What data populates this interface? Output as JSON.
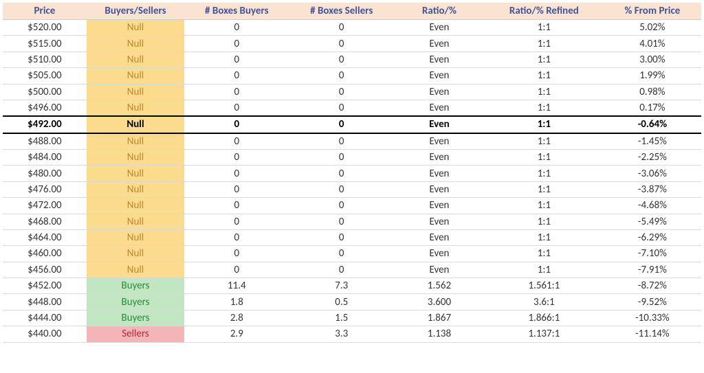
{
  "headers": {
    "price": "Price",
    "bs": "Buyers/Sellers",
    "boxBuyers": "# Boxes Buyers",
    "boxSellers": "# Boxes Sellers",
    "ratio": "Ratio/%",
    "ratioRefined": "Ratio/% Refined",
    "pctFromPrice": "% From Price"
  },
  "rows": [
    {
      "price": "$520.00",
      "bs": "Null",
      "bsClass": "null",
      "boxBuyers": "0",
      "boxSellers": "0",
      "ratio": "Even",
      "ratioRefined": "1:1",
      "pctFromPrice": "5.02%",
      "highlight": false
    },
    {
      "price": "$515.00",
      "bs": "Null",
      "bsClass": "null",
      "boxBuyers": "0",
      "boxSellers": "0",
      "ratio": "Even",
      "ratioRefined": "1:1",
      "pctFromPrice": "4.01%",
      "highlight": false
    },
    {
      "price": "$510.00",
      "bs": "Null",
      "bsClass": "null",
      "boxBuyers": "0",
      "boxSellers": "0",
      "ratio": "Even",
      "ratioRefined": "1:1",
      "pctFromPrice": "3.00%",
      "highlight": false
    },
    {
      "price": "$505.00",
      "bs": "Null",
      "bsClass": "null",
      "boxBuyers": "0",
      "boxSellers": "0",
      "ratio": "Even",
      "ratioRefined": "1:1",
      "pctFromPrice": "1.99%",
      "highlight": false
    },
    {
      "price": "$500.00",
      "bs": "Null",
      "bsClass": "null",
      "boxBuyers": "0",
      "boxSellers": "0",
      "ratio": "Even",
      "ratioRefined": "1:1",
      "pctFromPrice": "0.98%",
      "highlight": false
    },
    {
      "price": "$496.00",
      "bs": "Null",
      "bsClass": "null",
      "boxBuyers": "0",
      "boxSellers": "0",
      "ratio": "Even",
      "ratioRefined": "1:1",
      "pctFromPrice": "0.17%",
      "highlight": false
    },
    {
      "price": "$492.00",
      "bs": "Null",
      "bsClass": "null",
      "boxBuyers": "0",
      "boxSellers": "0",
      "ratio": "Even",
      "ratioRefined": "1:1",
      "pctFromPrice": "-0.64%",
      "highlight": true
    },
    {
      "price": "$488.00",
      "bs": "Null",
      "bsClass": "null",
      "boxBuyers": "0",
      "boxSellers": "0",
      "ratio": "Even",
      "ratioRefined": "1:1",
      "pctFromPrice": "-1.45%",
      "highlight": false
    },
    {
      "price": "$484.00",
      "bs": "Null",
      "bsClass": "null",
      "boxBuyers": "0",
      "boxSellers": "0",
      "ratio": "Even",
      "ratioRefined": "1:1",
      "pctFromPrice": "-2.25%",
      "highlight": false
    },
    {
      "price": "$480.00",
      "bs": "Null",
      "bsClass": "null",
      "boxBuyers": "0",
      "boxSellers": "0",
      "ratio": "Even",
      "ratioRefined": "1:1",
      "pctFromPrice": "-3.06%",
      "highlight": false
    },
    {
      "price": "$476.00",
      "bs": "Null",
      "bsClass": "null",
      "boxBuyers": "0",
      "boxSellers": "0",
      "ratio": "Even",
      "ratioRefined": "1:1",
      "pctFromPrice": "-3.87%",
      "highlight": false
    },
    {
      "price": "$472.00",
      "bs": "Null",
      "bsClass": "null",
      "boxBuyers": "0",
      "boxSellers": "0",
      "ratio": "Even",
      "ratioRefined": "1:1",
      "pctFromPrice": "-4.68%",
      "highlight": false
    },
    {
      "price": "$468.00",
      "bs": "Null",
      "bsClass": "null",
      "boxBuyers": "0",
      "boxSellers": "0",
      "ratio": "Even",
      "ratioRefined": "1:1",
      "pctFromPrice": "-5.49%",
      "highlight": false
    },
    {
      "price": "$464.00",
      "bs": "Null",
      "bsClass": "null",
      "boxBuyers": "0",
      "boxSellers": "0",
      "ratio": "Even",
      "ratioRefined": "1:1",
      "pctFromPrice": "-6.29%",
      "highlight": false
    },
    {
      "price": "$460.00",
      "bs": "Null",
      "bsClass": "null",
      "boxBuyers": "0",
      "boxSellers": "0",
      "ratio": "Even",
      "ratioRefined": "1:1",
      "pctFromPrice": "-7.10%",
      "highlight": false
    },
    {
      "price": "$456.00",
      "bs": "Null",
      "bsClass": "null",
      "boxBuyers": "0",
      "boxSellers": "0",
      "ratio": "Even",
      "ratioRefined": "1:1",
      "pctFromPrice": "-7.91%",
      "highlight": false
    },
    {
      "price": "$452.00",
      "bs": "Buyers",
      "bsClass": "buyers",
      "boxBuyers": "11.4",
      "boxSellers": "7.3",
      "ratio": "1.562",
      "ratioRefined": "1.561:1",
      "pctFromPrice": "-8.72%",
      "highlight": false
    },
    {
      "price": "$448.00",
      "bs": "Buyers",
      "bsClass": "buyers",
      "boxBuyers": "1.8",
      "boxSellers": "0.5",
      "ratio": "3.600",
      "ratioRefined": "3.6:1",
      "pctFromPrice": "-9.52%",
      "highlight": false
    },
    {
      "price": "$444.00",
      "bs": "Buyers",
      "bsClass": "buyers",
      "boxBuyers": "2.8",
      "boxSellers": "1.5",
      "ratio": "1.867",
      "ratioRefined": "1.866:1",
      "pctFromPrice": "-10.33%",
      "highlight": false
    },
    {
      "price": "$440.00",
      "bs": "Sellers",
      "bsClass": "sellers",
      "boxBuyers": "2.9",
      "boxSellers": "3.3",
      "ratio": "1.138",
      "ratioRefined": "1.137:1",
      "pctFromPrice": "-11.14%",
      "highlight": false
    }
  ]
}
